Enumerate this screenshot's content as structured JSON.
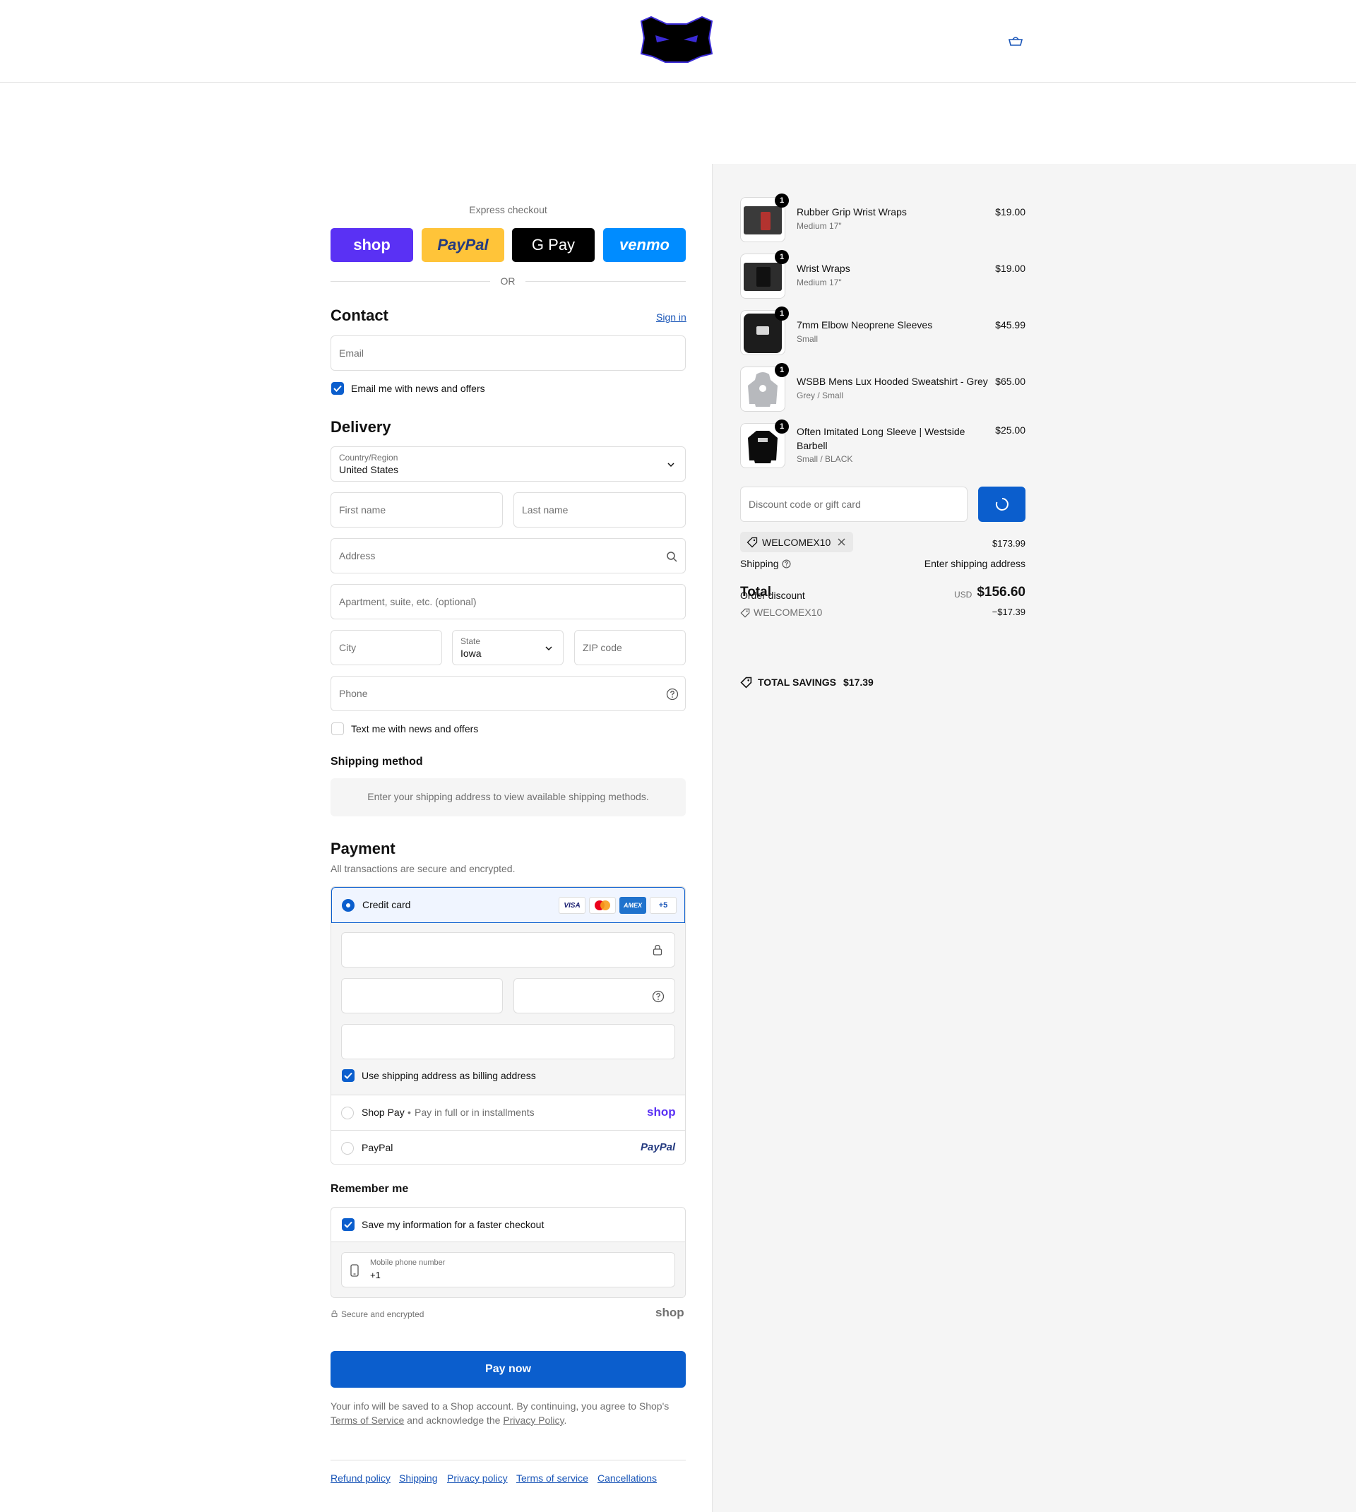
{
  "header": {
    "logo_alt": "store logo",
    "cart_icon": "shopping-bag-icon"
  },
  "express": {
    "title": "Express checkout",
    "buttons": [
      {
        "label": "shop",
        "color": "#5a31f4",
        "text_color": "#ffffff"
      },
      {
        "label": "PayPal",
        "color": "#ffc439",
        "text_color": "#253b80"
      },
      {
        "label": "G Pay",
        "color": "#000000",
        "text_color": "#ffffff"
      },
      {
        "label": "venmo",
        "color": "#008cff",
        "text_color": "#ffffff"
      }
    ],
    "divider": "OR"
  },
  "contact": {
    "title": "Contact",
    "sign_in": "Sign in",
    "email_placeholder": "Email",
    "email_news_label": "Email me with news and offers",
    "email_news_checked": true
  },
  "delivery": {
    "title": "Delivery",
    "country_label": "Country/Region",
    "country_value": "United States",
    "first_name": "First name",
    "last_name": "Last name",
    "address": "Address",
    "apartment": "Apartment, suite, etc. (optional)",
    "city": "City",
    "state_label": "State",
    "state_value": "Iowa",
    "zip": "ZIP code",
    "phone": "Phone",
    "text_news_label": "Text me with news and offers",
    "text_news_checked": false
  },
  "shipping_method": {
    "title": "Shipping method",
    "notice": "Enter your shipping address to view available shipping methods."
  },
  "payment": {
    "title": "Payment",
    "subtitle": "All transactions are secure and encrypted.",
    "credit_card_label": "Credit card",
    "card_brands": [
      "VISA",
      "mastercard",
      "AMEX",
      "+5"
    ],
    "billing_label": "Use shipping address as billing address",
    "billing_checked": true,
    "shop_pay_label": "Shop Pay",
    "shop_pay_sub": "Pay in full or in installments",
    "shop_pay_logo": "shop",
    "paypal_label": "PayPal",
    "paypal_logo": "PayPal"
  },
  "remember": {
    "title": "Remember me",
    "save_label": "Save my information for a faster checkout",
    "save_checked": true,
    "phone_label": "Mobile phone number",
    "phone_value": "+1",
    "secure_label": "Secure and encrypted",
    "shop_logo": "shop"
  },
  "pay_now": "Pay now",
  "legal": {
    "line1": "Your info will be saved to a Shop account. By continuing, you agree to Shop's",
    "terms": "Terms of Service",
    "mid": "and acknowledge the",
    "privacy": "Privacy Policy",
    "end": "."
  },
  "footer_links": [
    "Refund policy",
    "Shipping",
    "Privacy policy",
    "Terms of service",
    "Cancellations"
  ],
  "cart": {
    "items": [
      {
        "name": "Rubber Grip Wrist Wraps",
        "variant": "Medium 17\"",
        "price": "$19.00",
        "qty": "1"
      },
      {
        "name": "Wrist Wraps",
        "variant": "Medium 17\"",
        "price": "$19.00",
        "qty": "1"
      },
      {
        "name": "7mm Elbow Neoprene Sleeves",
        "variant": "Small",
        "price": "$45.99",
        "qty": "1"
      },
      {
        "name": "WSBB Mens Lux Hooded Sweatshirt - Grey",
        "variant": "Grey / Small",
        "price": "$65.00",
        "qty": "1"
      },
      {
        "name": "Often Imitated Long Sleeve | Westside Barbell",
        "variant": "Small / BLACK",
        "price": "$25.00",
        "qty": "1"
      }
    ],
    "discount_placeholder": "Discount code or gift card",
    "applied_code": "WELCOMEX10",
    "subtotal_value": "$173.99",
    "shipping_label": "Shipping",
    "shipping_value": "Enter shipping address",
    "order_discount_label": "Order discount",
    "discount_code": "WELCOMEX10",
    "discount_value": "−$17.39",
    "total_label": "Total",
    "currency": "USD",
    "total_value": "$156.60",
    "savings_label": "TOTAL SAVINGS",
    "savings_value": "$17.39"
  },
  "colors": {
    "accent": "#0b5ecd",
    "link": "#1a56b8",
    "summary_bg": "#f5f5f5"
  }
}
